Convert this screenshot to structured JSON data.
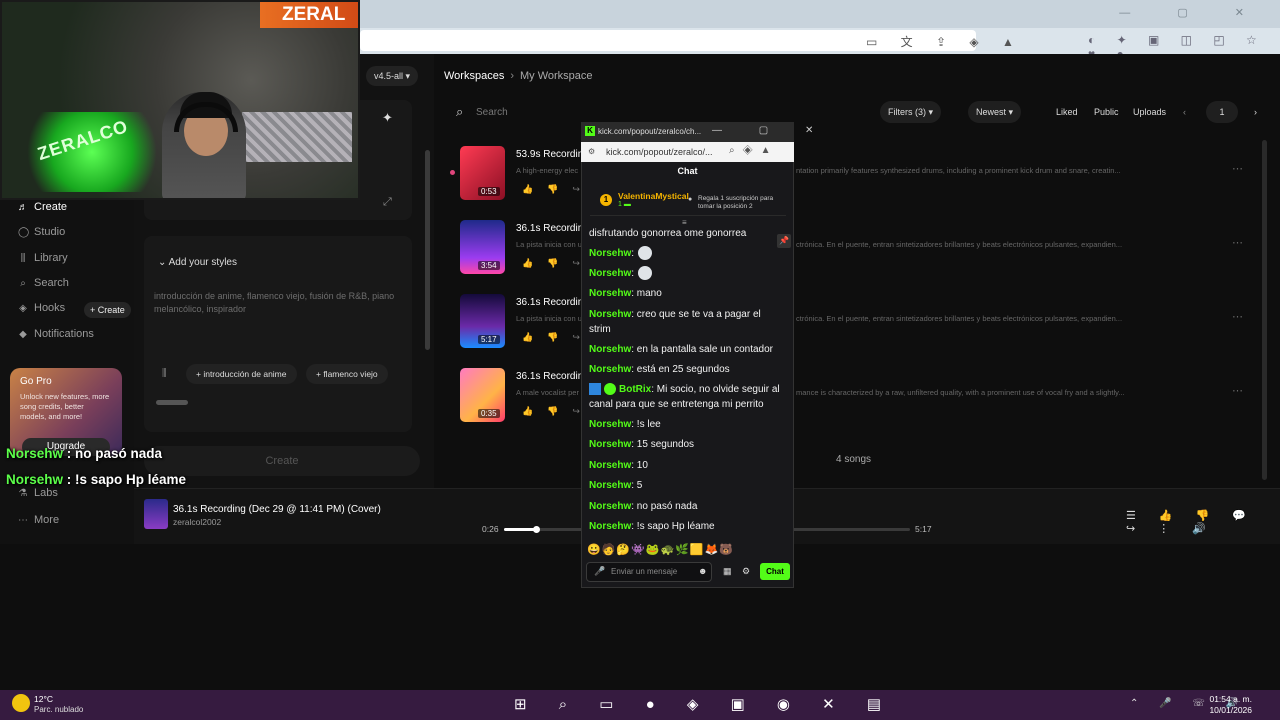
{
  "browser": {
    "window_controls": "— ▢ ✕",
    "addr_icons": "▭ 文 ⇪ ◈ ▲",
    "ext_icons": "◐ ✦ ▣ ◫ ◰ ☆ ♥ ●"
  },
  "app": {
    "version": "v4.5-all ▾",
    "sidebar": {
      "items": [
        {
          "label": "Create",
          "icon": "♬"
        },
        {
          "label": "Studio",
          "icon": "◯"
        },
        {
          "label": "Library",
          "icon": "⫼"
        },
        {
          "label": "Search",
          "icon": "⌕"
        },
        {
          "label": "Hooks",
          "icon": "◈"
        },
        {
          "label": "Notifications",
          "icon": "◆"
        },
        {
          "label": "Labs",
          "icon": "⚗"
        },
        {
          "label": "More",
          "icon": "⋯"
        }
      ],
      "create_pill": "+ Create",
      "go_pro": {
        "title": "Go Pro",
        "desc": "Unlock new features, more song credits, better models, and more!",
        "button": "Upgrade"
      }
    },
    "create_panel": {
      "styles_header": "Add your styles",
      "styles_placeholder": "introducción de anime, flamenco viejo, fusión de R&B, piano melancólico, inspirador",
      "chips": [
        "+  introducción de anime",
        "+  flamenco viejo"
      ],
      "create_button": "Create"
    },
    "workspace": {
      "breadcrumb_root": "Workspaces",
      "breadcrumb_sep": "›",
      "breadcrumb_current": "My Workspace",
      "search_placeholder": "Search",
      "filters": "Filters (3) ▾",
      "sort": "Newest ▾",
      "liked": "Liked",
      "public": "Public",
      "uploads": "Uploads",
      "page": "1",
      "songs": [
        {
          "title": "53.9s Recording",
          "duration": "0:53",
          "desc": "A high-energy elec",
          "desc2": "ntation primarily features synthesized drums, including a prominent kick drum and snare, creatin..."
        },
        {
          "title": "36.1s Recording",
          "duration": "3:54",
          "desc": "La pista inicia con u",
          "desc2": "ctrónica. En el puente, entran sintetizadores brillantes y beats electrónicos pulsantes, expandien..."
        },
        {
          "title": "36.1s Recording",
          "duration": "5:17",
          "desc": "La pista inicia con u",
          "desc2": "ctrónica. En el puente, entran sintetizadores brillantes y beats electrónicos pulsantes, expandien..."
        },
        {
          "title": "36.1s Recording",
          "duration": "0:35",
          "desc": "A male vocalist per",
          "desc2": "mance is characterized by a raw, unfiltered quality, with a prominent use of vocal fry and a slightly..."
        }
      ],
      "song_count": "4 songs"
    },
    "player": {
      "title": "36.1s Recording (Dec 29 @ 11:41 PM) (Cover)",
      "artist": "zeralcol2002",
      "time_current": "0:26",
      "time_total": "5:17",
      "progress": 0.08,
      "controls": "☰ 👍 👎 💬 ↪ ⋮ 🔊"
    }
  },
  "stream_overlay": {
    "brand": "ZERAL",
    "cam_logo": "ZERALCO",
    "lines": [
      {
        "user": "Norsehw",
        "text": " : no pasó nada"
      },
      {
        "user": "Norsehw",
        "text": " : !s sapo Hp léame"
      }
    ]
  },
  "kick_popout": {
    "window_title": "kick.com/popout/zeralco/ch...",
    "window_controls": "— ▢ ✕",
    "url": "kick.com/popout/zeralco/...",
    "chat_label": "Chat",
    "pinned": {
      "badge": "1",
      "user": "ValentinaMystical",
      "sub": "1 ▬",
      "text": "Regala 1 suscripción para tomar la posición 2"
    },
    "messages": [
      {
        "user": "",
        "text": "disfrutando gonorrea ome gonorrea"
      },
      {
        "user": "Norsehw",
        "text": ":",
        "emote": true
      },
      {
        "user": "Norsehw",
        "text": ":",
        "emote": true
      },
      {
        "user": "Norsehw",
        "text": ": mano"
      },
      {
        "user": "Norsehw",
        "text": ": creo que se te va a pagar el strim"
      },
      {
        "user": "Norsehw",
        "text": ": en la pantalla sale un contador"
      },
      {
        "user": "Norsehw",
        "text": ": está en 25 segundos"
      },
      {
        "user": "BotRix",
        "text": ": Mi socio, no olvide seguir al canal para que se entretenga mi perrito"
      },
      {
        "user": "Norsehw",
        "text": ": !s lee"
      },
      {
        "user": "Norsehw",
        "text": ": 15 segundos"
      },
      {
        "user": "Norsehw",
        "text": ": 10"
      },
      {
        "user": "Norsehw",
        "text": ": 5"
      },
      {
        "user": "Norsehw",
        "text": ": no pasó nada"
      },
      {
        "user": "Norsehw",
        "text": ": !s sapo Hp léame"
      }
    ],
    "emotes_row": "😀🧑🤔👾🐸🐢🌿🟨🦊🐻",
    "input_placeholder": "Enviar un mensaje",
    "send_label": "Chat"
  },
  "taskbar": {
    "temp": "12°C",
    "weather": "Parc. nublado",
    "apps": "⊞ ⌕ ▭ ● ◈ ▣ ◉ ✕ ▤",
    "tray": "⌃ 🎤 ☏ 🔊",
    "time": "01:54 a. m.",
    "date": "10/01/2026"
  }
}
